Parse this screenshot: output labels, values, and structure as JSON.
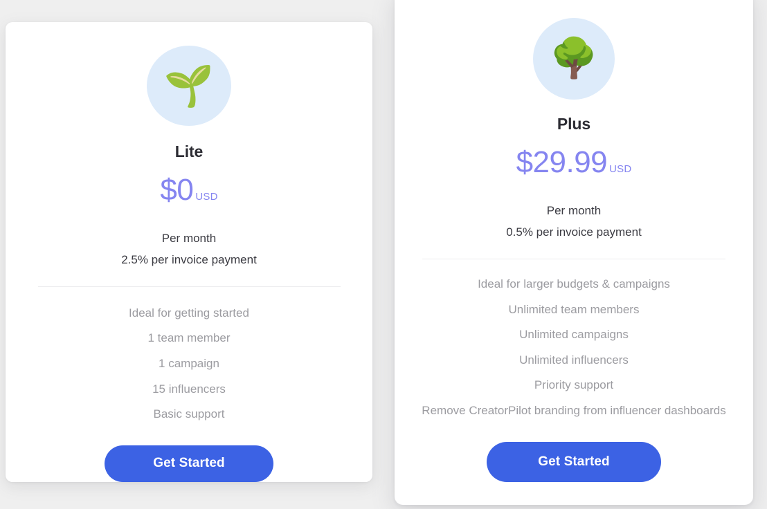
{
  "theme": {
    "page_background": "#efefef",
    "card_background": "#ffffff",
    "accent_price_color": "#8585f0",
    "cta_button_color": "#3c62e4",
    "icon_badge_color": "#ddebfa",
    "heading_color": "#2c2c33",
    "billing_text_color": "#3b3b42",
    "feature_text_color": "#9c9ca1",
    "divider_color": "#ececee"
  },
  "plans": [
    {
      "id": "lite",
      "icon": "seedling-icon",
      "icon_glyph": "🌱",
      "name": "Lite",
      "price_amount": "$0",
      "price_currency": "USD",
      "billing_period": "Per month",
      "billing_fee": "2.5% per invoice payment",
      "features": [
        "Ideal for getting started",
        "1 team member",
        "1 campaign",
        "15 influencers",
        "Basic support"
      ],
      "cta_label": "Get Started"
    },
    {
      "id": "plus",
      "icon": "tree-icon",
      "icon_glyph": "🌳",
      "name": "Plus",
      "price_amount": "$29.99",
      "price_currency": "USD",
      "billing_period": "Per month",
      "billing_fee": "0.5% per invoice payment",
      "features": [
        "Ideal for larger budgets & campaigns",
        "Unlimited team members",
        "Unlimited campaigns",
        "Unlimited influencers",
        "Priority support",
        "Remove CreatorPilot branding from influencer dashboards"
      ],
      "cta_label": "Get Started"
    }
  ]
}
